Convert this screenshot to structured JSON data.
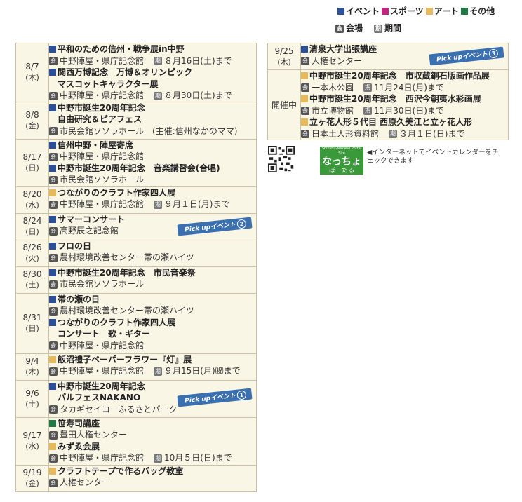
{
  "legend": {
    "event": "イベント",
    "sports": "スポーツ",
    "art": "アート",
    "other": "その他",
    "venue": "会場",
    "period": "期間",
    "colors": {
      "event": "#2c4f9a",
      "sports": "#c0267e",
      "art": "#e6b95a",
      "other": "#1f7a45"
    }
  },
  "left": [
    {
      "date": "8/7",
      "dow": "(木)",
      "h": 78,
      "items": [
        {
          "cat": "event",
          "lines": [
            "平和のための信州・戦争展in中野"
          ],
          "loc": "中野陣屋・県庁記念館",
          "term": "８月16日(土)まで"
        },
        {
          "cat": "event",
          "lines": [
            "関西万博記念　万博＆オリンピック",
            "マスコットキャラクター展"
          ],
          "loc": "中野陣屋・県庁記念館",
          "term": "８月30日(土)まで"
        }
      ]
    },
    {
      "date": "8/8",
      "dow": "(金)",
      "h": 53,
      "items": [
        {
          "cat": "event",
          "lines": [
            "中野市誕生20周年記念",
            "自由研究＆ピアフェス"
          ],
          "loc": "市民会館ソソラホール　(主催:信州なかのママ)",
          "term": ""
        }
      ]
    },
    {
      "date": "8/17",
      "dow": "(日)",
      "h": 68,
      "items": [
        {
          "cat": "event",
          "lines": [
            "信州中野・陣屋寄席"
          ],
          "loc": "中野陣屋・県庁記念館",
          "term": ""
        },
        {
          "cat": "event",
          "lines": [
            "中野市誕生20周年記念　音楽講習会(合唱)"
          ],
          "loc": "市民会館ソソラホール",
          "term": ""
        }
      ]
    },
    {
      "date": "8/20",
      "dow": "(水)",
      "h": 38,
      "items": [
        {
          "cat": "art",
          "lines": [
            "つながりのクラフト作家四人展"
          ],
          "loc": "中野陣屋・県庁記念館",
          "term": "９月１日(月)まで"
        }
      ]
    },
    {
      "date": "8/24",
      "dow": "(日)",
      "h": 38,
      "pick": "2",
      "items": [
        {
          "cat": "event",
          "lines": [
            "サマーコンサート"
          ],
          "loc": "高野辰之記念館",
          "term": ""
        }
      ]
    },
    {
      "date": "8/26",
      "dow": "(火)",
      "h": 38,
      "items": [
        {
          "cat": "event",
          "lines": [
            "フロの日"
          ],
          "loc": "農村環境改善センター帯の瀬ハイツ",
          "term": ""
        }
      ]
    },
    {
      "date": "8/30",
      "dow": "(土)",
      "h": 38,
      "items": [
        {
          "cat": "event",
          "lines": [
            "中野市誕生20周年記念　市民音楽祭"
          ],
          "loc": "市民会館ソソラホール",
          "term": ""
        }
      ]
    },
    {
      "date": "8/31",
      "dow": "(日)",
      "h": 86,
      "items": [
        {
          "cat": "event",
          "lines": [
            "帯の瀬の日"
          ],
          "loc": "農村環境改善センター帯の瀬ハイツ",
          "term": ""
        },
        {
          "cat": "event",
          "lines": [
            "つながりのクラフト作家四人展",
            "コンサート　歌・ギター"
          ],
          "loc": "中野陣屋・県庁記念館",
          "term": ""
        }
      ]
    },
    {
      "date": "9/4",
      "dow": "(木)",
      "h": 38,
      "items": [
        {
          "cat": "art",
          "lines": [
            "飯沼禮子ペーパーフラワー『灯』展"
          ],
          "loc": "中野陣屋・県庁記念館",
          "term": "９月15日(月)㈷まで"
        }
      ]
    },
    {
      "date": "9/6",
      "dow": "(土)",
      "h": 53,
      "pick": "1",
      "items": [
        {
          "cat": "event",
          "lines": [
            "中野市誕生20周年記念",
            "パルフェスNAKANO"
          ],
          "loc": "タカギセイコーふるさとパーク",
          "term": ""
        }
      ]
    },
    {
      "date": "9/17",
      "dow": "(水)",
      "h": 68,
      "items": [
        {
          "cat": "other",
          "lines": [
            "笹寿司講座"
          ],
          "loc": "豊田人権センター",
          "term": ""
        },
        {
          "cat": "art",
          "lines": [
            "みずゑ会展"
          ],
          "loc": "中野陣屋・県庁記念館",
          "term": "10月５日(日)まで"
        }
      ]
    },
    {
      "date": "9/19",
      "dow": "(金)",
      "h": 38,
      "items": [
        {
          "cat": "art",
          "lines": [
            "クラフトテープで作るバッグ教室"
          ],
          "loc": "人権センター",
          "term": ""
        }
      ]
    }
  ],
  "right": [
    {
      "date": "9/25",
      "dow": "(木)",
      "h": 38,
      "pick": "3",
      "items": [
        {
          "cat": "event",
          "lines": [
            "清泉大学出張講座"
          ],
          "loc": "人権センター",
          "term": ""
        }
      ]
    },
    {
      "date": "開催中",
      "dow": "",
      "h": 100,
      "items": [
        {
          "cat": "art",
          "lines": [
            "中野市誕生20周年記念　市収蔵銅石版画作品展"
          ],
          "loc": "一本木公園",
          "term": "11月24日(月)まで"
        },
        {
          "cat": "art",
          "lines": [
            "中野市誕生20周年記念　西沢今朝夷水彩画展"
          ],
          "loc": "市立博物館",
          "term": "11月30日(日)まで"
        },
        {
          "cat": "art",
          "lines": [
            "立ヶ花人形５代目 西原久美江と立ヶ花人形"
          ],
          "loc": "日本土人形資料館",
          "term": "３月１日(日)まで"
        }
      ]
    }
  ],
  "pickup_label": "Pick upイベント",
  "promo": {
    "logo_top": "Shinshu-Nakano Portal Site",
    "logo_main": "なっちょ",
    "logo_sub": "ぽーたる",
    "note": "◀インターネットでイベントカレンダーをチェックできます"
  },
  "icon_venue": "会",
  "icon_period": "期"
}
